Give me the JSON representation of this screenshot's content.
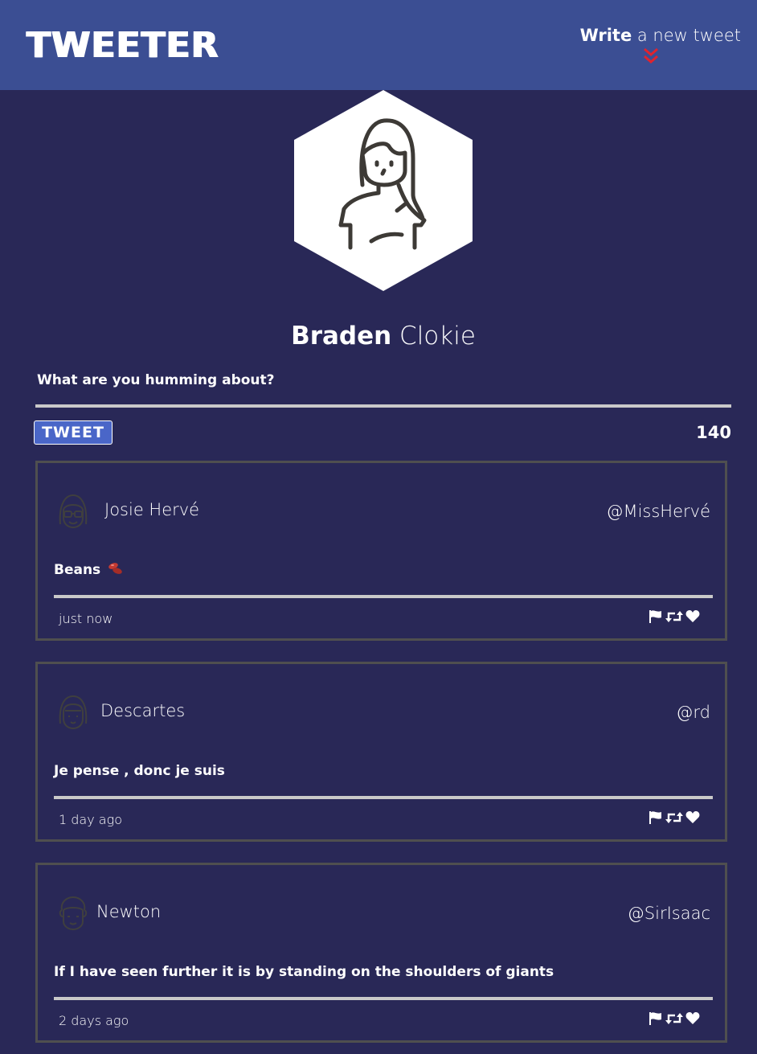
{
  "nav": {
    "logo": "TWEETER",
    "compose_strong": "Write",
    "compose_rest": "a new tweet",
    "compose_icon": "chevron-double-down-icon",
    "accent": "#e0232e"
  },
  "profile": {
    "first_name": "Braden",
    "last_name": "Clokie",
    "avatar_icon": "person-icon"
  },
  "composer": {
    "prompt": "What are you humming about?",
    "button_label": "TWEET",
    "counter": "140"
  },
  "tweets": [
    {
      "name": "Josie Hervé",
      "handle": "@MissHervé",
      "text": "Beans",
      "emoji_icon": "beans-icon",
      "time": "just now",
      "avatar_icon": "glasses-person-icon"
    },
    {
      "name": "Descartes",
      "handle": "@rd",
      "text": "Je pense , donc je suis",
      "time": "1 day ago",
      "avatar_icon": "bangs-person-icon"
    },
    {
      "name": "Newton",
      "handle": "@SirIsaac",
      "text": "If I have seen further it is by standing on the shoulders of giants",
      "time": "2 days ago",
      "avatar_icon": "curly-hair-person-icon"
    }
  ],
  "colors": {
    "background": "#292857",
    "navbar": "#3b4e93",
    "button": "#4a66c8",
    "card_border": "#4f4f4f",
    "rule": "#c9c9c9"
  }
}
